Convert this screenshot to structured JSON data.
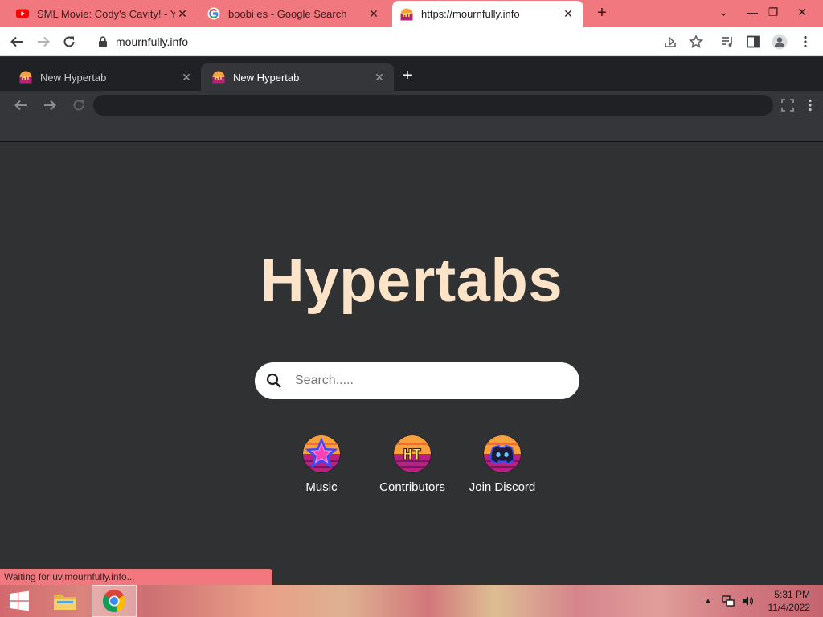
{
  "browser": {
    "tabs": [
      {
        "title": "SML Movie: Cody's Cavity! - YouTube",
        "icon": "youtube-icon",
        "active": false
      },
      {
        "title": "boobi es - Google Search",
        "icon": "google-icon",
        "active": false
      },
      {
        "title": "https://mournfully.info",
        "icon": "hypertabs-favicon",
        "active": true
      }
    ],
    "address": "mournfully.info",
    "status_text": "Waiting for uv.mournfully.info..."
  },
  "hypertabs": {
    "tabs": [
      {
        "title": "New Hypertab",
        "active": false
      },
      {
        "title": "New Hypertab",
        "active": true
      }
    ],
    "logo": "Hypertabs",
    "search_placeholder": "Search.....",
    "links": [
      {
        "label": "Music",
        "icon": "music-star-icon"
      },
      {
        "label": "Contributors",
        "icon": "contributors-ht-icon"
      },
      {
        "label": "Join Discord",
        "icon": "discord-icon"
      }
    ]
  },
  "taskbar": {
    "time": "5:31 PM",
    "date": "11/4/2022"
  },
  "colors": {
    "accent": "#f0787e",
    "logo": "#fde3c7",
    "page_bg": "#2f3133",
    "inner_toolbar": "#35363a",
    "inner_tabstrip": "#202124"
  }
}
